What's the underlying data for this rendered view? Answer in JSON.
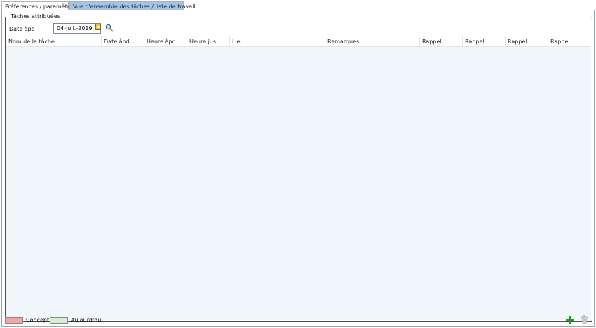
{
  "tabs": [
    {
      "label": "Préférences / paramètres",
      "active": false
    },
    {
      "label": "Vue d'ensemble des tâches / liste de travail",
      "active": true
    }
  ],
  "group": {
    "title": "Tâches attribuées"
  },
  "filter": {
    "date_label": "Date àpd",
    "date_value": "04-juil.-2019"
  },
  "table": {
    "columns": [
      "Nom de la tâche",
      "Date àpd",
      "Heure àpd",
      "Heure jus...",
      "Lieu",
      "Remarques",
      "Rappel",
      "Rappel",
      "Rappel",
      "Rappel"
    ],
    "rows": []
  },
  "legend": [
    {
      "label": "Concept",
      "color": "#f4a6a6"
    },
    {
      "label": "Aujourd'hui",
      "color": "#d4f0c8"
    }
  ],
  "icons": {
    "calendar": "calendar-icon",
    "search": "search-icon",
    "add": "plus-icon",
    "delete": "trash-icon"
  },
  "colors": {
    "active_tab": "#a7c3e0",
    "grid_background": "#f1f6fb",
    "add_icon": "#1f9a1f"
  }
}
